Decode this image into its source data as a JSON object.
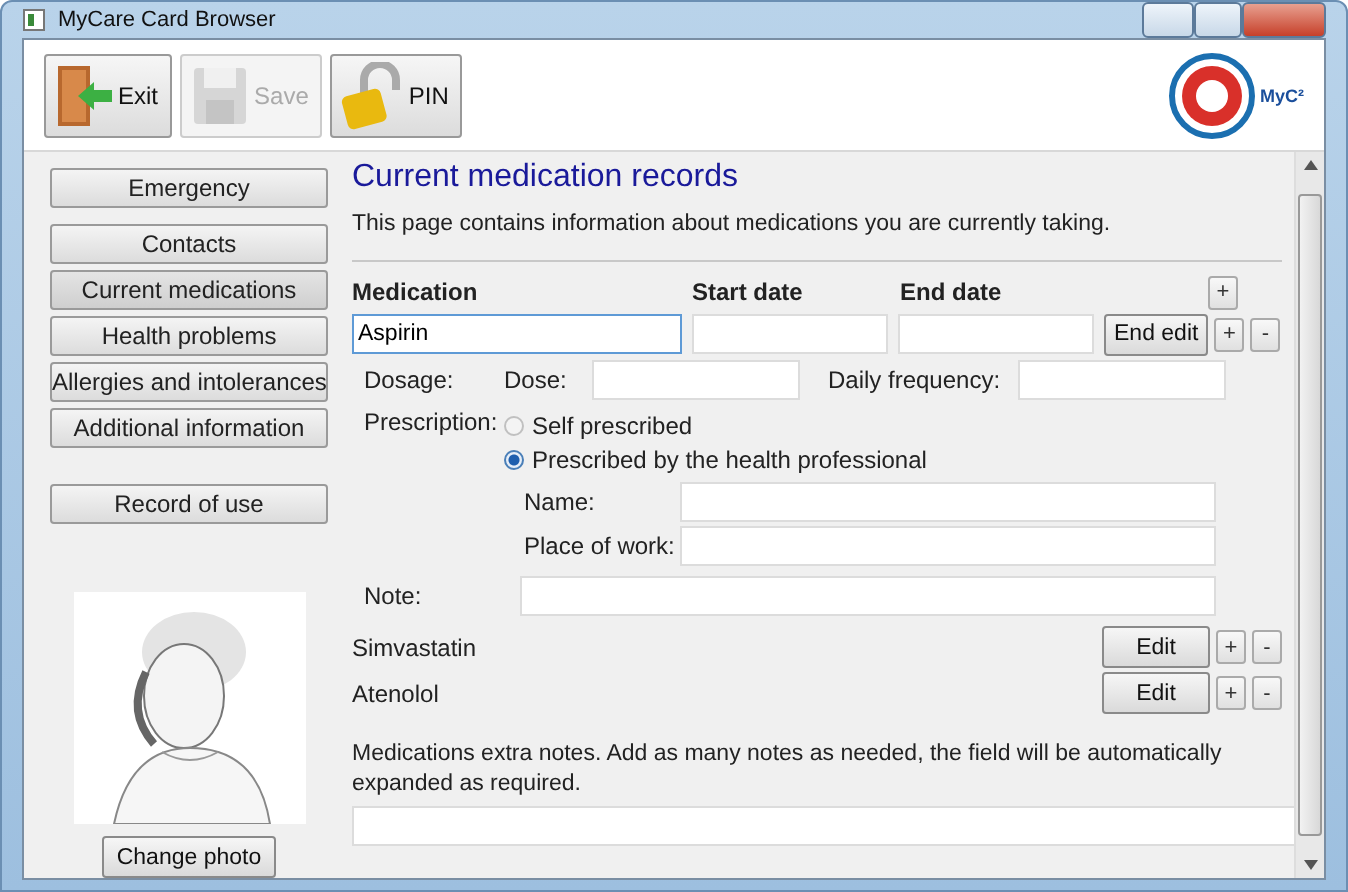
{
  "window": {
    "title": "MyCare Card Browser"
  },
  "toolbar": {
    "buttons": [
      {
        "label": "Exit",
        "kind": "exit",
        "disabled": false
      },
      {
        "label": "Save",
        "kind": "save",
        "disabled": true
      },
      {
        "label": "PIN",
        "kind": "pin",
        "disabled": false
      }
    ],
    "logo": {
      "text": "MyC²"
    }
  },
  "sidebar": {
    "items": [
      {
        "label": "Emergency",
        "selected": false
      },
      {
        "label": "Contacts",
        "selected": false
      },
      {
        "label": "Current medications",
        "selected": true
      },
      {
        "label": "Health problems",
        "selected": false
      },
      {
        "label": "Allergies and intolerances",
        "selected": false
      },
      {
        "label": "Additional information",
        "selected": false
      }
    ],
    "record_button": "Record of use",
    "change_photo": "Change photo"
  },
  "page": {
    "title": "Current medication records",
    "description": "This page contains information about medications you are currently taking.",
    "columns": [
      "Medication",
      "Start date",
      "End date"
    ],
    "editing": {
      "medication": "Aspirin",
      "end_edit": "End edit",
      "dosage_label": "Dosage:",
      "dose_label": "Dose:",
      "frequency_label": "Daily frequency:",
      "prescription_label": "Prescription:",
      "options": [
        {
          "label": "Self prescribed",
          "selected": false
        },
        {
          "label": "Prescribed by the health professional",
          "selected": true
        }
      ],
      "name_label": "Name:",
      "work_label": "Place of work:",
      "note_label": "Note:"
    },
    "add_symbol": "+",
    "remove_symbol": "-",
    "medications": [
      {
        "name": "Simvastatin",
        "edit": "Edit"
      },
      {
        "name": "Atenolol",
        "edit": "Edit"
      }
    ],
    "extra_notes": "Medications extra notes. Add as many notes as needed, the field will be automatically expanded as required."
  }
}
